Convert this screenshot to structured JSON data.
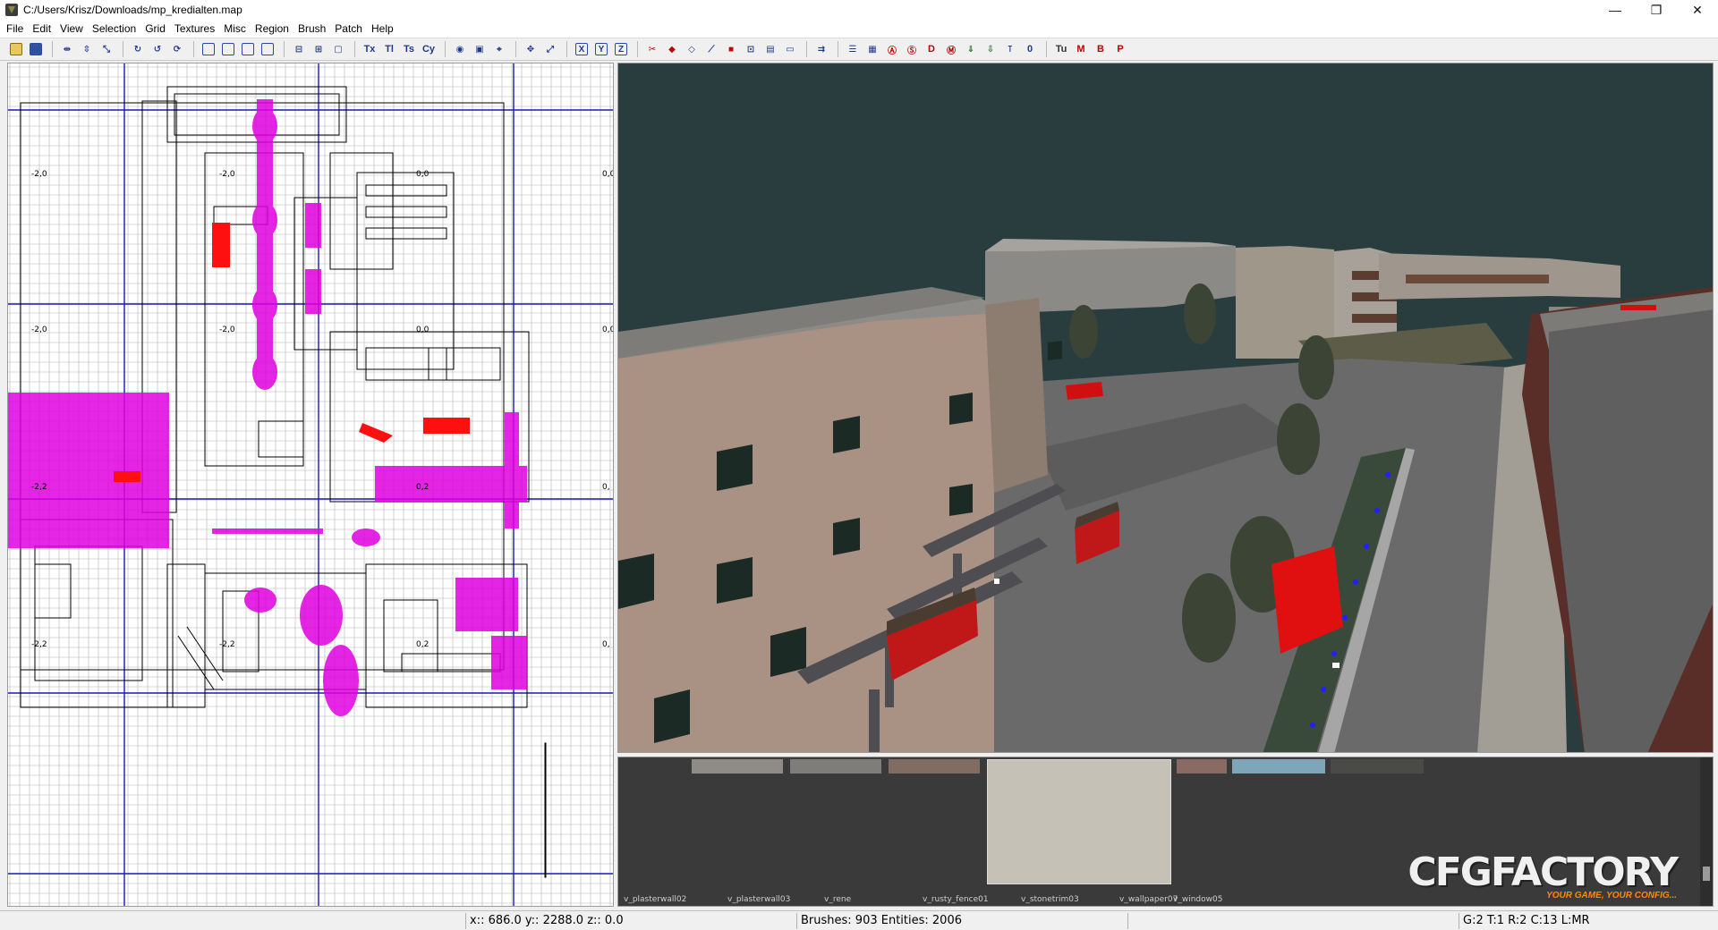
{
  "window": {
    "title": "C:/Users/Krisz/Downloads/mp_kredialten.map",
    "controls": [
      "—",
      "❐",
      "✕"
    ]
  },
  "menu": [
    "File",
    "Edit",
    "View",
    "Selection",
    "Grid",
    "Textures",
    "Misc",
    "Region",
    "Brush",
    "Patch",
    "Help"
  ],
  "toolbar": {
    "text_buttons": [
      {
        "name": "toolbar-tex-t-button",
        "label": "Tu"
      },
      {
        "name": "toolbar-m-button",
        "label": "M"
      },
      {
        "name": "toolbar-b-button",
        "label": "B"
      },
      {
        "name": "toolbar-p-button",
        "label": "P"
      }
    ],
    "axis_buttons": [
      "X",
      "Y",
      "Z"
    ]
  },
  "xy_view": {
    "grid_coords": [
      "-2,0",
      "-2,0",
      "0,0",
      "0,0",
      "-2,0",
      "-2,0",
      "0,0",
      "0,0",
      "-2,2",
      "0,2",
      "0,",
      "-2,2",
      "-2,2",
      "0,2",
      "0,"
    ]
  },
  "texture_browser": {
    "textures": [
      "v_plasterwall02",
      "v_plasterwall03",
      "v_rene",
      "v_rusty_fence01",
      "v_stonetrim03",
      "v_wallpaper07",
      "v_window05"
    ]
  },
  "watermark": {
    "main": "CFGFACTORY",
    "sub": "YOUR GAME, YOUR CONFIG..."
  },
  "status": {
    "coords": "x:: 686.0  y:: 2288.0  z:: 0.0",
    "counts": "Brushes: 903 Entities: 2006",
    "grid": "G:2 T:1 R:2 C:13 L:MR"
  }
}
